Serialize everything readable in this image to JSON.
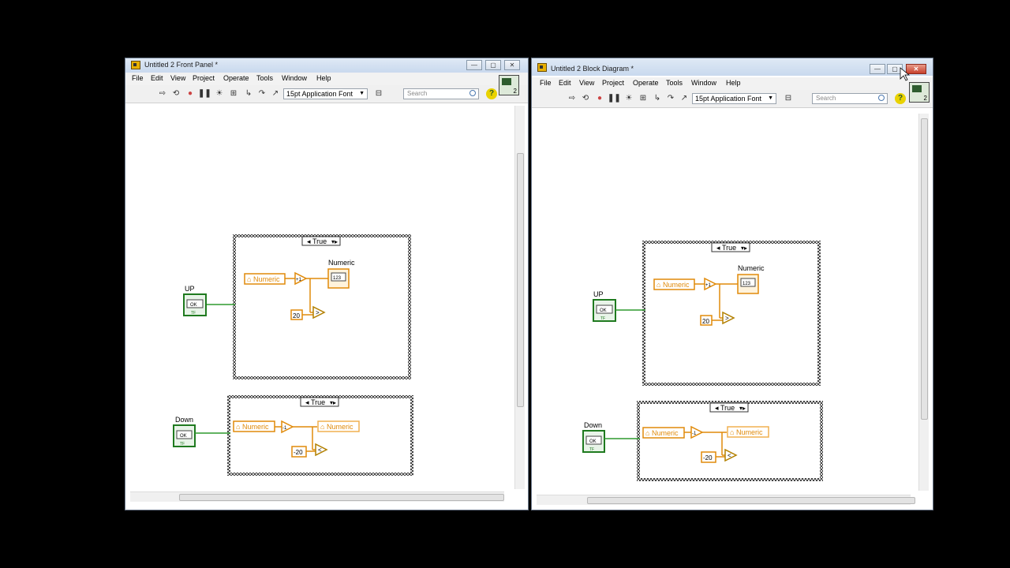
{
  "front_panel": {
    "title": "Untitled 2 Front Panel *",
    "menus": [
      "File",
      "Edit",
      "View",
      "Project",
      "Operate",
      "Tools",
      "Window",
      "Help"
    ],
    "font_dropdown": "15pt Application Font",
    "search_placeholder": "Search",
    "vi_icon_number": "2"
  },
  "block_diagram": {
    "title": "Untitled 2 Block Diagram *",
    "menus": [
      "File",
      "Edit",
      "View",
      "Project",
      "Operate",
      "Tools",
      "Window",
      "Help"
    ],
    "font_dropdown": "15pt Application Font",
    "search_placeholder": "Search",
    "vi_icon_number": "2"
  },
  "diagram": {
    "up_label": "UP",
    "down_label": "Down",
    "button_text": "OK",
    "bool_text": "TF",
    "case_selector": "True",
    "numeric_local": "Numeric",
    "numeric_indicator_label": "Numeric",
    "numeric_indicator_digits": "123",
    "increment_glyph": "+1",
    "decrement_glyph": "-1",
    "up_limit": "20",
    "down_limit": "-20",
    "greater_glyph": ">",
    "less_glyph": "<"
  },
  "colors": {
    "wire_green": "#2f9a2f",
    "numeric_orange": "#e08a0a",
    "boolean_green": "#1f7a1f"
  }
}
